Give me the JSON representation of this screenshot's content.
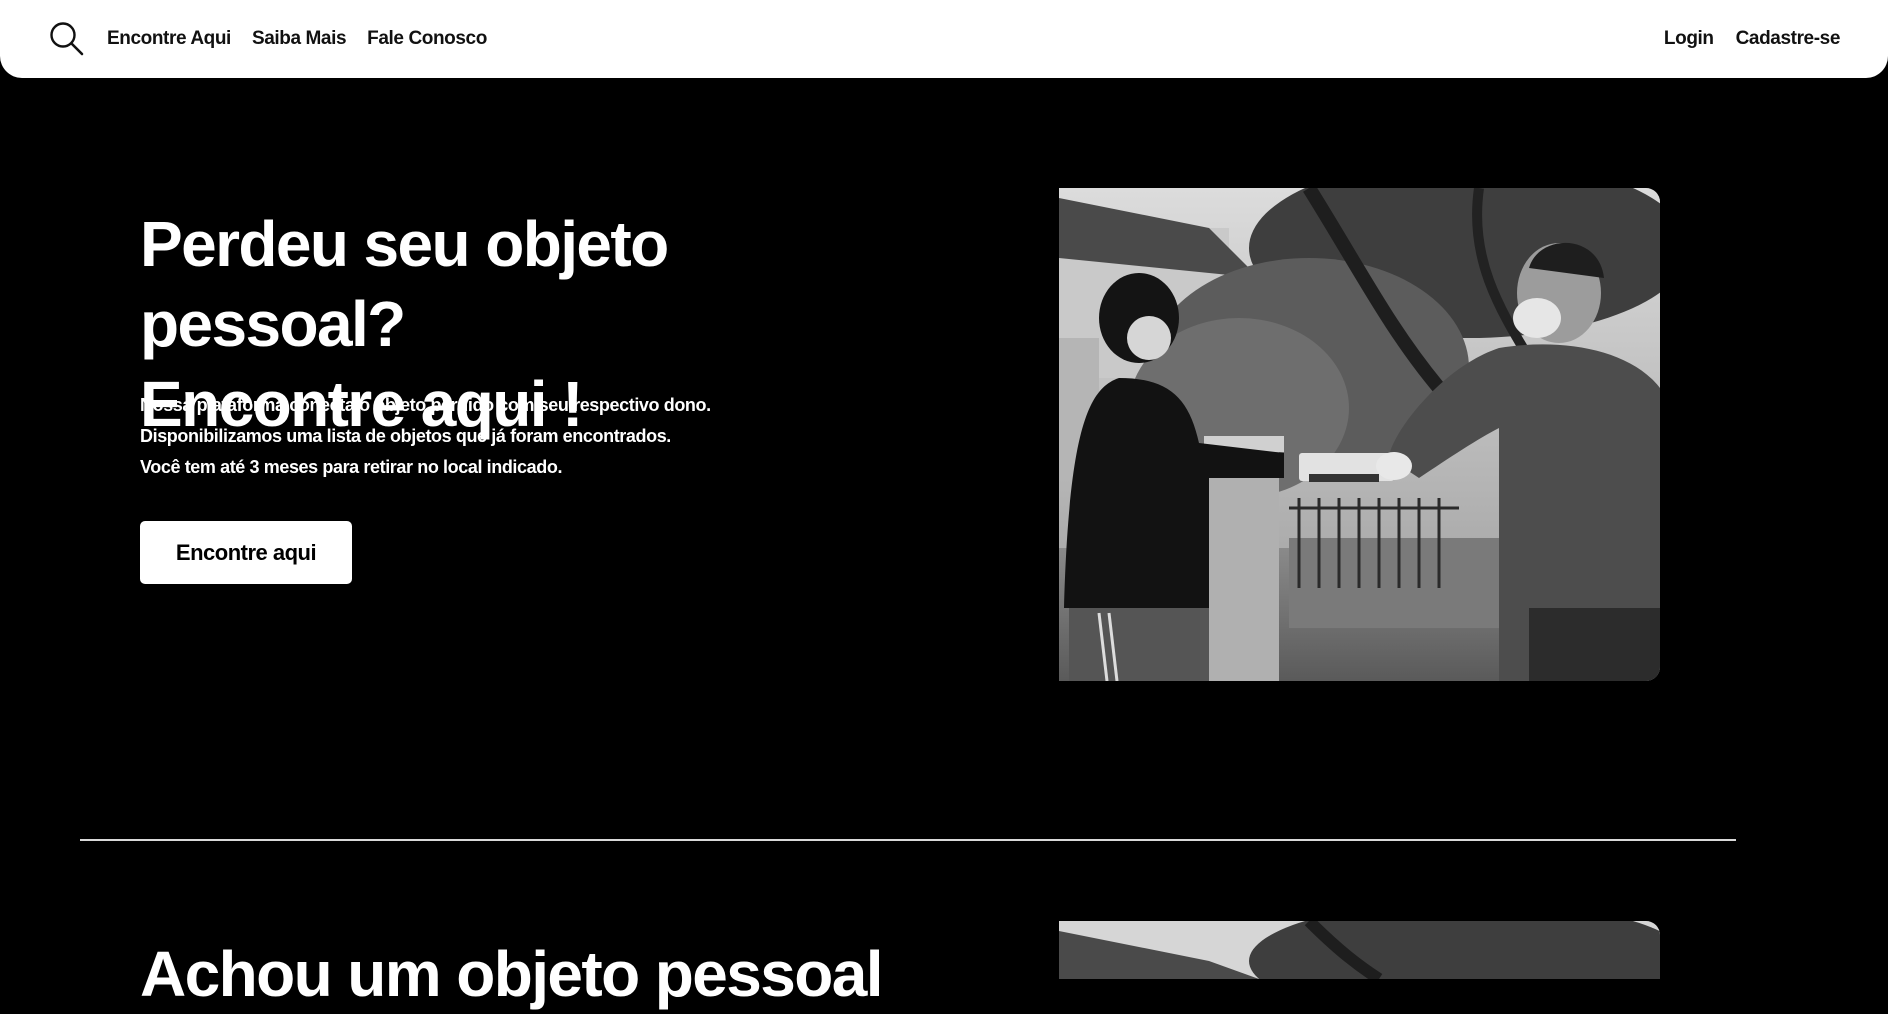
{
  "nav": {
    "search_icon": "search-icon",
    "links": [
      "Encontre Aqui",
      "Saiba Mais",
      "Fale Conosco"
    ],
    "login": "Login",
    "signup": "Cadastre-se"
  },
  "hero": {
    "title_line1": "Perdeu seu objeto pessoal?",
    "title_line2": "Encontre aqui !",
    "desc_line1": "Nossa plataforma conecta o objeto perdido com seu respectivo dono.",
    "desc_line2": "Disponibilizamos uma lista de objetos que já foram encontrados.",
    "desc_line3": "Você tem até 3 meses para retirar no local indicado.",
    "cta": "Encontre aqui"
  },
  "section2": {
    "title": "Achou um objeto pessoal"
  }
}
